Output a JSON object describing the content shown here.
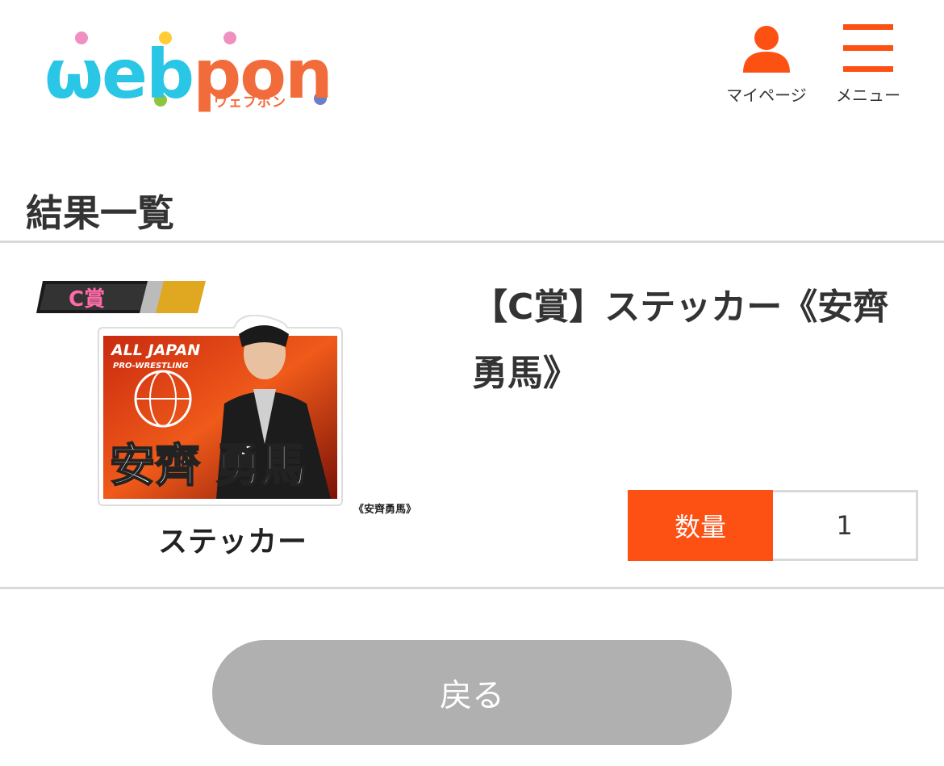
{
  "header": {
    "logo": {
      "wordmark": "webpon",
      "subtitle": "ウェブポン"
    },
    "mypage_label": "マイページ",
    "menu_label": "メニュー",
    "accent_color": "#fd5013"
  },
  "section": {
    "title": "結果一覧"
  },
  "item": {
    "rank_badge": "C賞",
    "image": {
      "brand_top": "ALL JAPAN",
      "brand_sub": "PRO-WRESTLING",
      "name_on_sticker": "安齊 勇馬",
      "caption": "《安齊勇馬》",
      "label": "ステッカー"
    },
    "title": "【C賞】ステッカー《安齊勇馬》",
    "quantity_label": "数量",
    "quantity_value": "1"
  },
  "back_button": {
    "label": "戻る"
  }
}
